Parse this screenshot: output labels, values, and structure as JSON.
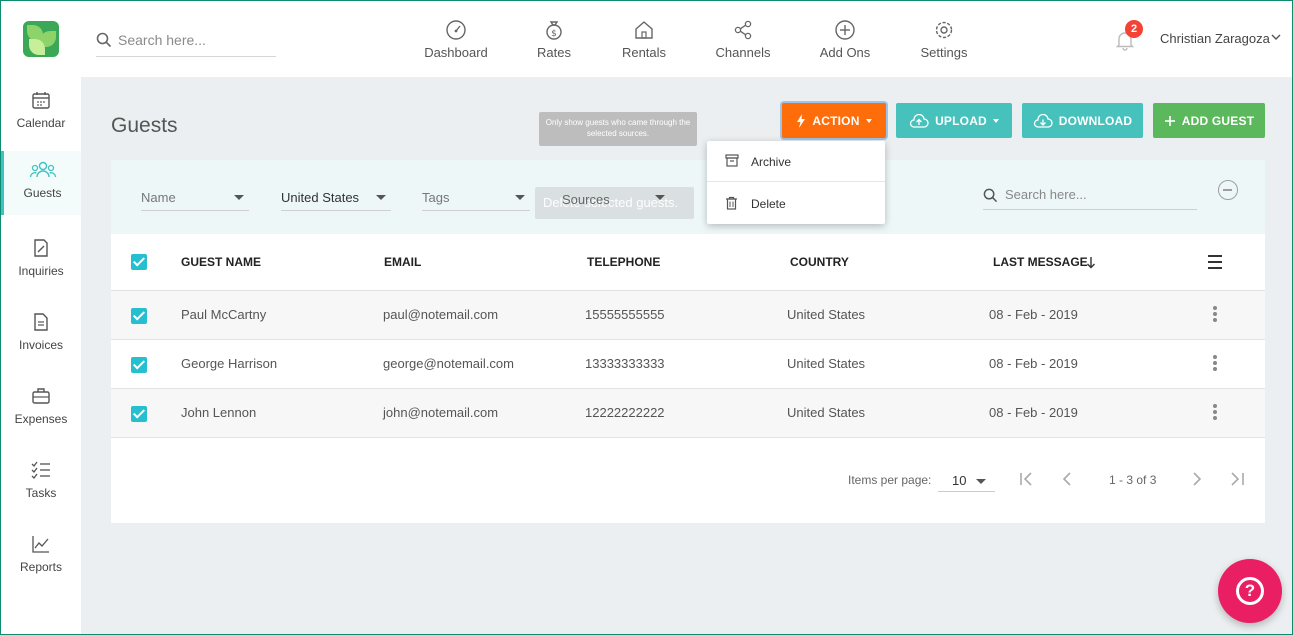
{
  "topbar": {
    "search_placeholder": "Search here...",
    "nav": [
      {
        "label": "Dashboard",
        "icon": "gauge-icon"
      },
      {
        "label": "Rates",
        "icon": "money-bag-icon"
      },
      {
        "label": "Rentals",
        "icon": "home-icon"
      },
      {
        "label": "Channels",
        "icon": "share-icon"
      },
      {
        "label": "Add Ons",
        "icon": "plus-circle-icon"
      },
      {
        "label": "Settings",
        "icon": "gear-icon"
      }
    ],
    "notification_count": "2",
    "user_name": "Christian Zaragoza"
  },
  "sidebar": {
    "items": [
      {
        "label": "Calendar",
        "icon": "calendar-icon"
      },
      {
        "label": "Guests",
        "icon": "people-icon",
        "active": true
      },
      {
        "label": "Inquiries",
        "icon": "edit-note-icon"
      },
      {
        "label": "Invoices",
        "icon": "document-icon"
      },
      {
        "label": "Expenses",
        "icon": "briefcase-icon"
      },
      {
        "label": "Tasks",
        "icon": "checklist-icon"
      },
      {
        "label": "Reports",
        "icon": "trend-icon"
      }
    ]
  },
  "page": {
    "title": "Guests",
    "tooltip_top": "Only show guests who came through the selected sources.",
    "tooltip_ghost": "Delete selected guests."
  },
  "actions": {
    "action": "ACTION",
    "upload": "UPLOAD",
    "download": "DOWNLOAD",
    "add_guest": "ADD GUEST",
    "menu": [
      "Archive",
      "Delete"
    ]
  },
  "filters": {
    "name": "Name",
    "country": "United States",
    "tags": "Tags",
    "sources": "Sources",
    "search_placeholder": "Search here..."
  },
  "table": {
    "headers": [
      "GUEST NAME",
      "EMAIL",
      "TELEPHONE",
      "COUNTRY",
      "LAST MESSAGE"
    ],
    "rows": [
      {
        "name": "Paul McCartny",
        "email": "paul@notemail.com",
        "phone": "15555555555",
        "country": "United States",
        "last": "08 - Feb - 2019"
      },
      {
        "name": "George Harrison",
        "email": "george@notemail.com",
        "phone": "13333333333",
        "country": "United States",
        "last": "08 - Feb - 2019"
      },
      {
        "name": "John Lennon",
        "email": "john@notemail.com",
        "phone": "12222222222",
        "country": "United States",
        "last": "08 - Feb - 2019"
      }
    ]
  },
  "pager": {
    "items_label": "Items per page:",
    "per_page": "10",
    "range": "1 - 3 of 3"
  },
  "colors": {
    "action": "#ff6d0a",
    "teal": "#46c1bb",
    "green": "#5cb85c",
    "help": "#e91e63"
  }
}
